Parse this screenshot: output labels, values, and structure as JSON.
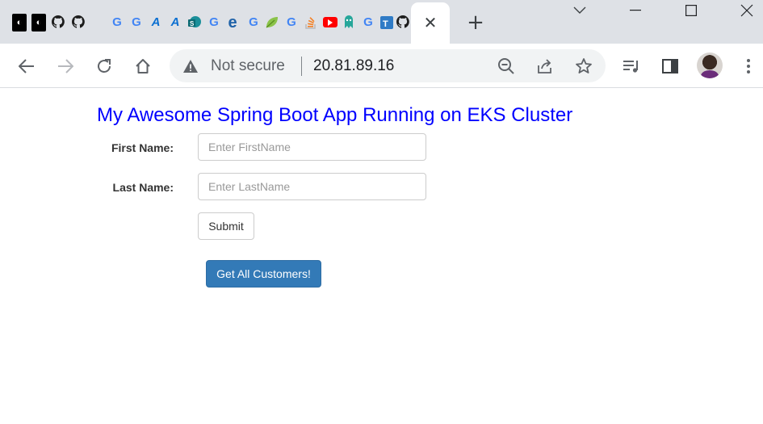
{
  "browser": {
    "tab_favicons": [
      "dark-square-icon",
      "dark-square-icon",
      "github-icon",
      "github-icon",
      "microsoft-icon",
      "google-icon",
      "google-icon",
      "azure-icon",
      "azure-icon",
      "sharepoint-icon",
      "google-icon",
      "edge-icon",
      "google-icon",
      "leaf-icon",
      "google-icon",
      "stackoverflow-icon",
      "youtube-icon",
      "teal-icon",
      "google-icon",
      "tr-icon",
      "github-icon"
    ],
    "active_tab_close": "✕",
    "new_tab": "+",
    "address_bar": {
      "security_text": "Not secure",
      "url": "20.81.89.16"
    }
  },
  "page": {
    "heading": "My Awesome Spring Boot App Running on EKS Cluster",
    "form": {
      "first_name_label": "First Name:",
      "first_name_placeholder": "Enter FirstName",
      "first_name_value": "",
      "last_name_label": "Last Name:",
      "last_name_placeholder": "Enter LastName",
      "last_name_value": "",
      "submit_label": "Submit"
    },
    "get_all_label": "Get All Customers!"
  },
  "colors": {
    "heading": "#0000ff",
    "primary_button": "#337ab7",
    "tab_strip": "#dee1e6",
    "omnibox": "#f1f3f4"
  }
}
